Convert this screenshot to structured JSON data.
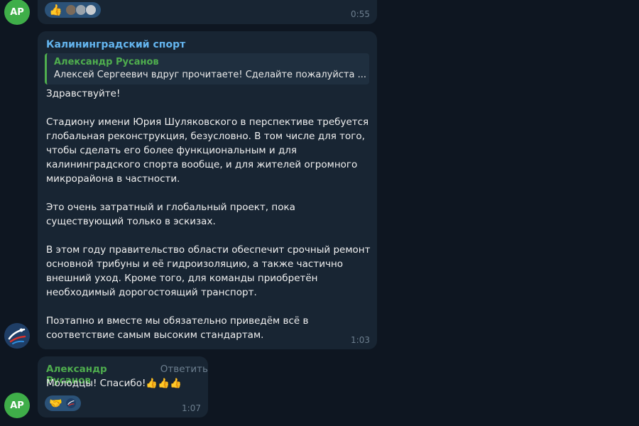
{
  "avatars": {
    "top_initials": "AP",
    "bottom_initials": "AP"
  },
  "message1": {
    "time": "0:55",
    "reaction_emoji": "👍"
  },
  "message2": {
    "channel_name": "Калининградский спорт",
    "reply_author": "Александр Русанов",
    "reply_text": "Алексей Сергеевич вдруг прочитаете! Сделайте пожалуйста ...",
    "body": "Здравствуйте!\n\nСтадиону имени Юрия Шуляковского в перспективе требуется глобальная реконструкция, безусловно. В том числе для того, чтобы сделать его более функциональным и для калининградского спорта вообще, и для жителей огромного микрорайона в частности.\n\nЭто очень затратный и глобальный проект, пока существующий только в эскизах.\n\nВ этом году правительство области обеспечит срочный ремонт основной трибуны и её гидроизоляцию, а также частично внешний уход. Кроме того, для команды приобретён необходимый дорогостоящий транспорт.\n\nПоэтапно и вместе мы обязательно приведём всё в соответствие самым высоким стандартам.",
    "time": "1:03"
  },
  "message3": {
    "sender": "Александр Русанов",
    "reply_link": "Ответить",
    "text": "Молодцы! Спасибо!👍👍👍",
    "reaction_emoji": "🤝",
    "time": "1:07"
  },
  "colors": {
    "background": "#0e1621",
    "bubble": "#182533",
    "accent_green": "#4fae4e",
    "accent_blue": "#64b5ef",
    "muted": "#6d7f8f"
  }
}
